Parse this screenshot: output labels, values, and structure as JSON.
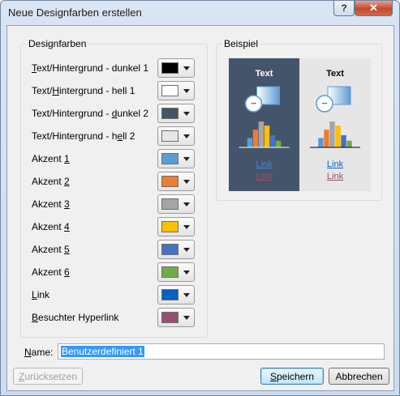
{
  "window": {
    "title": "Neue Designfarben erstellen",
    "help_label": "?",
    "close_label": "✕"
  },
  "groups": {
    "colors_title": "Designfarben",
    "preview_title": "Beispiel"
  },
  "rows": [
    {
      "pre": "",
      "u": "T",
      "post": "ext/Hintergrund - dunkel 1",
      "color": "#000000"
    },
    {
      "pre": "Text/",
      "u": "H",
      "post": "intergrund - hell 1",
      "color": "#ffffff"
    },
    {
      "pre": "Text/Hintergrund - ",
      "u": "d",
      "post": "unkel 2",
      "color": "#44546a"
    },
    {
      "pre": "Text/Hintergrund - h",
      "u": "e",
      "post": "ll 2",
      "color": "#e7e6e6"
    },
    {
      "pre": "Akzent ",
      "u": "1",
      "post": "",
      "color": "#5b9bd5"
    },
    {
      "pre": "Akzent ",
      "u": "2",
      "post": "",
      "color": "#ed7d31"
    },
    {
      "pre": "Akzent ",
      "u": "3",
      "post": "",
      "color": "#a5a5a5"
    },
    {
      "pre": "Akzent ",
      "u": "4",
      "post": "",
      "color": "#ffc000"
    },
    {
      "pre": "Akzent ",
      "u": "5",
      "post": "",
      "color": "#4472c4"
    },
    {
      "pre": "Akzent ",
      "u": "6",
      "post": "",
      "color": "#70ad47"
    },
    {
      "pre": "",
      "u": "L",
      "post": "ink",
      "color": "#0563c1"
    },
    {
      "pre": "",
      "u": "B",
      "post": "esuchter Hyperlink",
      "color": "#954f72"
    }
  ],
  "preview": {
    "dark_text": "Text",
    "light_text": "Text",
    "link": "Link",
    "visited_link": "Link",
    "bar_colors": [
      "#5b9bd5",
      "#ed7d31",
      "#a5a5a5",
      "#ffc000",
      "#4472c4",
      "#70ad47"
    ],
    "bar_levels": [
      0.35,
      0.65,
      0.95,
      0.8,
      0.45,
      0.25
    ]
  },
  "name": {
    "pre": "",
    "u": "N",
    "post": "ame:",
    "value": "Benutzerdefiniert 1"
  },
  "buttons": {
    "reset": {
      "pre": "",
      "u": "Z",
      "post": "urücksetzen"
    },
    "save": {
      "pre": "",
      "u": "S",
      "post": "peichern"
    },
    "cancel": "Abbrechen"
  }
}
